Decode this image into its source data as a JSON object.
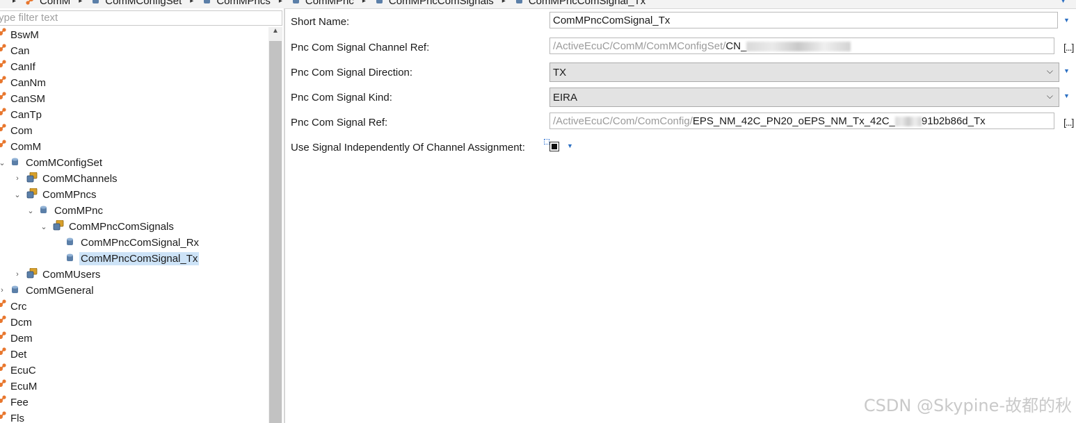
{
  "breadcrumb": {
    "items": [
      {
        "label": "ComM",
        "icon": "module-icon"
      },
      {
        "label": "ComMConfigSet",
        "icon": "container-icon"
      },
      {
        "label": "ComMPncs",
        "icon": "container-icon"
      },
      {
        "label": "ComMPnc",
        "icon": "container-icon"
      },
      {
        "label": "ComMPncComSignals",
        "icon": "container-icon"
      },
      {
        "label": "ComMPncComSignal_Tx",
        "icon": "container-icon"
      }
    ]
  },
  "filter": {
    "placeholder": "type filter text"
  },
  "tree": {
    "items": [
      {
        "label": "BswM",
        "level": 0,
        "icon": "module-icon",
        "expander": "none"
      },
      {
        "label": "Can",
        "level": 0,
        "icon": "module-icon",
        "expander": "none"
      },
      {
        "label": "CanIf",
        "level": 0,
        "icon": "module-icon",
        "expander": "none"
      },
      {
        "label": "CanNm",
        "level": 0,
        "icon": "module-icon",
        "expander": "none"
      },
      {
        "label": "CanSM",
        "level": 0,
        "icon": "module-icon",
        "expander": "none"
      },
      {
        "label": "CanTp",
        "level": 0,
        "icon": "module-icon",
        "expander": "none"
      },
      {
        "label": "Com",
        "level": 0,
        "icon": "module-icon",
        "expander": "none"
      },
      {
        "label": "ComM",
        "level": 0,
        "icon": "module-icon",
        "expander": "none"
      },
      {
        "label": "ComMConfigSet",
        "level": 1,
        "icon": "container-icon",
        "expander": "expanded"
      },
      {
        "label": "ComMChannels",
        "level": 2,
        "icon": "multi-container-icon",
        "expander": "collapsed"
      },
      {
        "label": "ComMPncs",
        "level": 2,
        "icon": "multi-container-icon",
        "expander": "expanded"
      },
      {
        "label": "ComMPnc",
        "level": 3,
        "icon": "container-icon",
        "expander": "expanded"
      },
      {
        "label": "ComMPncComSignals",
        "level": 4,
        "icon": "multi-container-icon",
        "expander": "expanded"
      },
      {
        "label": "ComMPncComSignal_Rx",
        "level": 5,
        "icon": "container-icon",
        "expander": "none"
      },
      {
        "label": "ComMPncComSignal_Tx",
        "level": 5,
        "icon": "container-icon",
        "expander": "none",
        "selected": true
      },
      {
        "label": "ComMUsers",
        "level": 2,
        "icon": "multi-container-icon",
        "expander": "collapsed"
      },
      {
        "label": "ComMGeneral",
        "level": 1,
        "icon": "container-icon",
        "expander": "collapsed"
      },
      {
        "label": "Crc",
        "level": 0,
        "icon": "module-icon",
        "expander": "none"
      },
      {
        "label": "Dcm",
        "level": 0,
        "icon": "module-icon",
        "expander": "none"
      },
      {
        "label": "Dem",
        "level": 0,
        "icon": "module-icon",
        "expander": "none"
      },
      {
        "label": "Det",
        "level": 0,
        "icon": "module-icon",
        "expander": "none"
      },
      {
        "label": "EcuC",
        "level": 0,
        "icon": "locked-module-icon",
        "expander": "none"
      },
      {
        "label": "EcuM",
        "level": 0,
        "icon": "module-icon",
        "expander": "none"
      },
      {
        "label": "Fee",
        "level": 0,
        "icon": "module-icon",
        "expander": "none"
      },
      {
        "label": "Fls",
        "level": 0,
        "icon": "module-icon",
        "expander": "none"
      }
    ]
  },
  "form": {
    "short_name": {
      "label": "Short Name:",
      "value": "ComMPncComSignal_Tx"
    },
    "channel_ref": {
      "label": "Pnc Com Signal Channel Ref:",
      "prefix": "/ActiveEcuC/ComM/ComMConfigSet/",
      "value": "CN_",
      "button": "[...]"
    },
    "direction": {
      "label": "Pnc Com Signal Direction:",
      "value": "TX"
    },
    "kind": {
      "label": "Pnc Com Signal Kind:",
      "value": "EIRA"
    },
    "signal_ref": {
      "label": "Pnc Com Signal Ref:",
      "prefix": "/ActiveEcuC/Com/ComConfig/",
      "value": "EPS_NM_42C_PN20_oEPS_NM_Tx_42C_",
      "suffix": "91b2b86d_Tx",
      "button": "[...]"
    },
    "use_signal": {
      "label": "Use Signal Independently Of Channel Assignment:",
      "checked": true
    }
  },
  "watermark": "CSDN @Skypine-故都的秋",
  "colors": {
    "selection": "#cde3f7",
    "module_icon": "#e8772e",
    "container_icon": "#5b7fa8",
    "multi_container_icon": "#d8a02b",
    "dropdown_arrow": "#2b6fc2"
  }
}
